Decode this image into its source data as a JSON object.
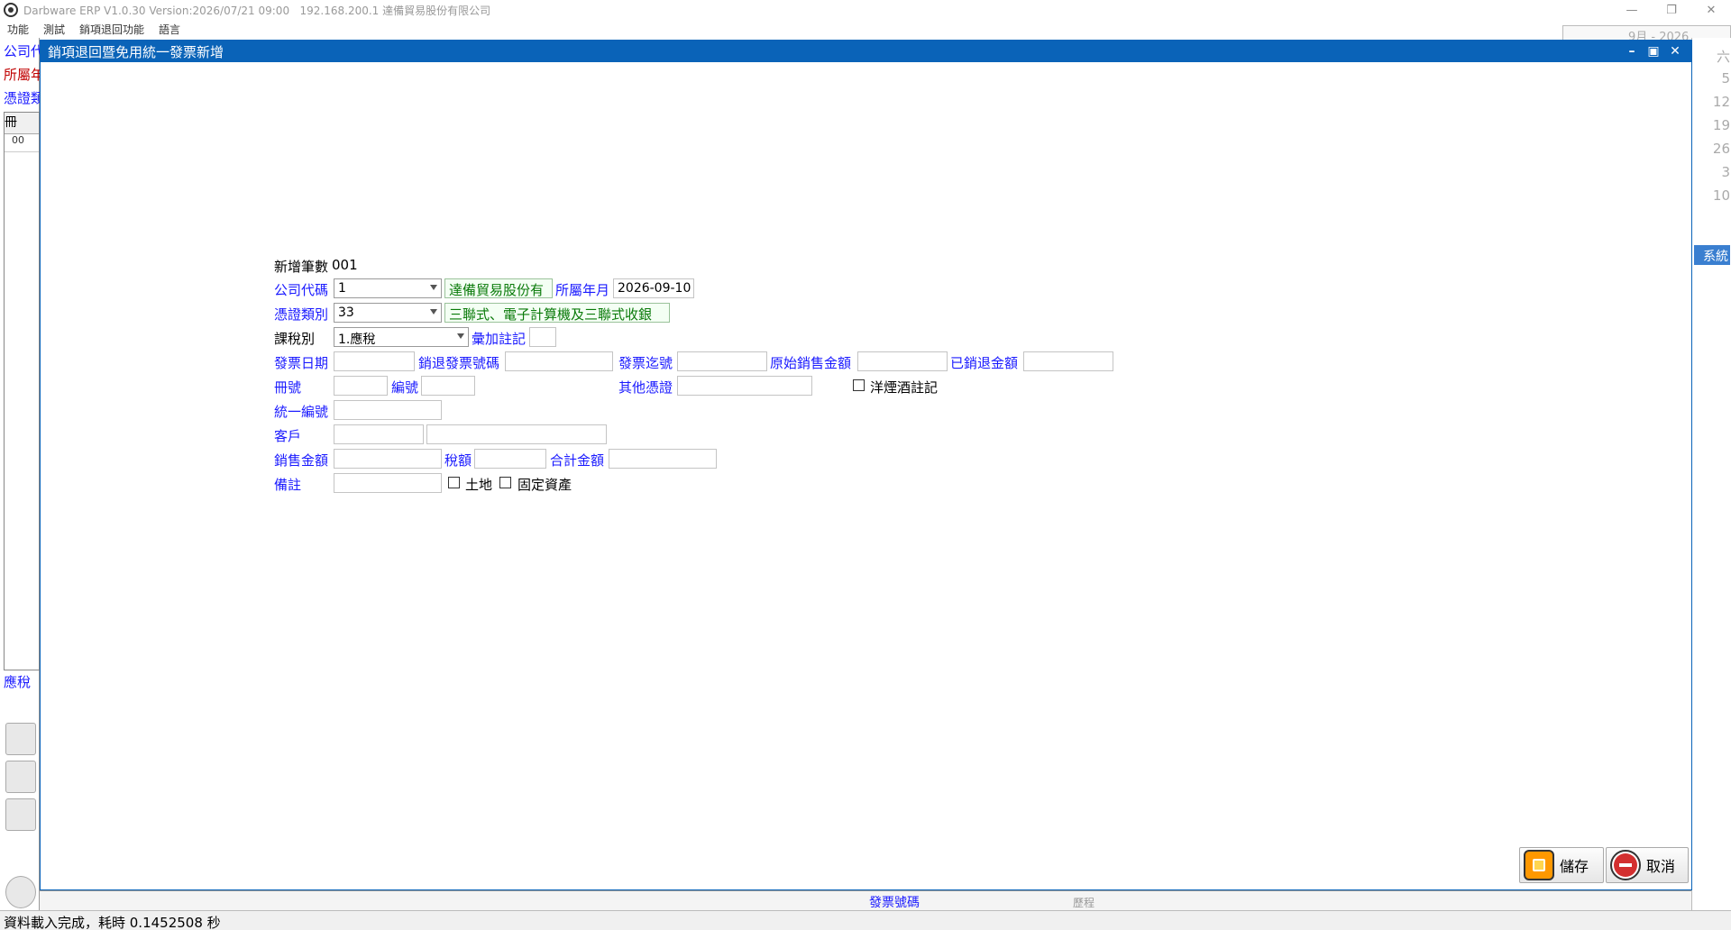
{
  "app": {
    "title": "Darbware ERP V1.0.30 Version:2026/07/21 09:00   192.168.200.1 達備貿易股份有限公司",
    "menu": [
      "功能",
      "測試",
      "銷項退回功能",
      "語言"
    ]
  },
  "background": {
    "labels": [
      "公司代",
      "所屬年",
      "憑證類"
    ],
    "grid_head": "冊",
    "grid_row": "00",
    "tax_label": "應稅",
    "calendar_header": "9月 - 2026",
    "calendar_weekday": "六",
    "calendar_days": [
      "5",
      "12",
      "19",
      "26",
      "3",
      "10"
    ],
    "right_btn_label": "系統",
    "bottom_label": "發票號碼",
    "bottom_radio": "歷程"
  },
  "dialog": {
    "title": "銷項退回暨免用統一發票新增",
    "count_label": "新增筆數",
    "count_value": "001",
    "company_code_label": "公司代碼",
    "company_code_value": "1",
    "company_name": "達備貿易股份有",
    "period_label": "所屬年月",
    "period_value": "2026-09-10",
    "voucher_type_label": "憑證類別",
    "voucher_type_value": "33",
    "voucher_type_desc": "三聯式、電子計算機及三聯式收銀",
    "tax_type_label": "課稅別",
    "tax_type_value": "1.應稅",
    "aggregate_label": "彙加註記",
    "invoice_date_label": "發票日期",
    "return_invoice_label": "銷退發票號碼",
    "invoice_end_label": "發票迄號",
    "original_sales_label": "原始銷售金額",
    "returned_amount_label": "已銷退金額",
    "book_no_label": "冊號",
    "serial_no_label": "編號",
    "other_voucher_label": "其他憑證",
    "liquor_label": "洋煙酒註記",
    "tax_id_label": "統一編號",
    "customer_label": "客戶",
    "sales_amount_label": "銷售金額",
    "tax_amount_label": "稅額",
    "total_amount_label": "合計金額",
    "remark_label": "備註",
    "land_label": "土地",
    "fixed_asset_label": "固定資產",
    "save_label": "儲存",
    "cancel_label": "取消"
  },
  "status": "資料載入完成，耗時 0.1452508 秒",
  "colors": {
    "title_blue": "#0a63b8",
    "label_blue": "#1a1aff",
    "readonly_green": "#0a7a0a"
  }
}
